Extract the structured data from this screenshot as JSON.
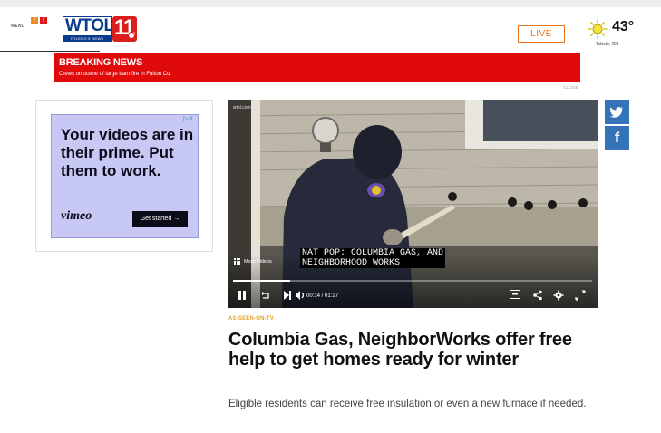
{
  "header": {
    "menu_label": "MENU",
    "alert_badges": [
      "!",
      "!"
    ],
    "logo": {
      "text": "WTOL",
      "number": "11",
      "tagline": "TOLEDO'S NEWS LEADER"
    },
    "live_label": "LIVE",
    "weather": {
      "icon": "sun-icon",
      "temperature": "43°",
      "city": "Toledo, OH"
    }
  },
  "breaking_news": {
    "title": "BREAKING NEWS",
    "text": "Crews on scene of large barn fire in Fulton Co.",
    "close_label": "CLOSE"
  },
  "ad": {
    "headline": "Your videos are in their prime. Put them to work.",
    "brand": "vimeo",
    "cta": "Get started →",
    "adchoices": "▷✕"
  },
  "video": {
    "watermark": "wtol.com",
    "caption_line1": "NAT POP: COLUMBIA GAS, AND",
    "caption_line2": "NEIGHBORHOOD WORKS",
    "more_videos_label": "More Videos",
    "current_time": "00:14",
    "duration": "01:27",
    "progress": 0.16,
    "time_separator": " / "
  },
  "social": {
    "twitter_glyph": "🐦",
    "facebook_glyph": "f"
  },
  "article": {
    "kicker": "AS-SEEN-ON-TV",
    "headline": "Columbia Gas, NeighborWorks offer free help to get homes ready for winter",
    "subhead": "Eligible residents can receive free insulation or even a new furnace if needed."
  },
  "colors": {
    "breaking_red": "#e00a0a",
    "live_orange": "#e8741e",
    "kicker_gold": "#e8a31c",
    "social_blue": "#3573b8",
    "ad_lavender": "#c7c8f4"
  }
}
